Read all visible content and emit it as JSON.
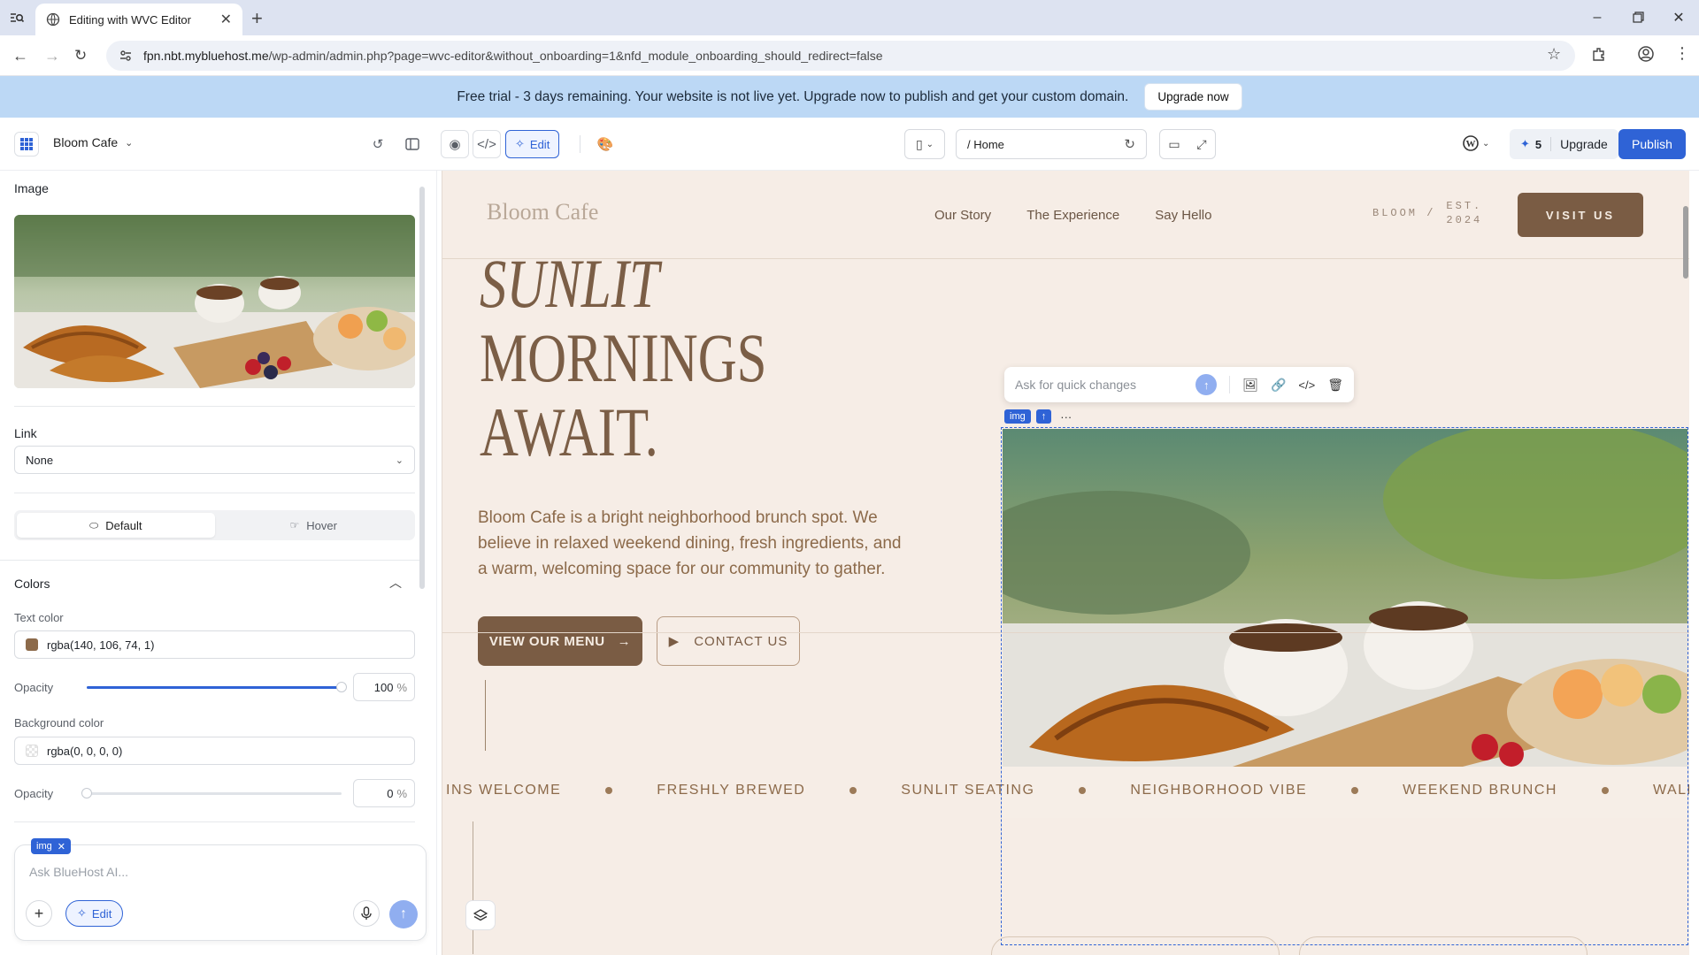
{
  "browser": {
    "tab_title": "Editing with WVC Editor",
    "url_host": "fpn.nbt.mybluehost.me",
    "url_path": "/wp-admin/admin.php?page=wvc-editor&without_onboarding=1&nfd_module_onboarding_should_redirect=false"
  },
  "banner": {
    "message": "Free trial - 3 days remaining. Your website is not live yet. Upgrade now to publish and get your custom domain.",
    "upgrade_label": "Upgrade now"
  },
  "editor": {
    "site_name": "Bloom Cafe",
    "edit_label": "Edit",
    "page_path": "/ Home",
    "credits": "5",
    "upgrade_label": "Upgrade",
    "publish_label": "Publish"
  },
  "sidebar": {
    "image_label": "Image",
    "link_label": "Link",
    "link_value": "None",
    "state_default": "Default",
    "state_hover": "Hover",
    "colors_label": "Colors",
    "text_color_label": "Text color",
    "text_color_value": "rgba(140, 106, 74, 1)",
    "text_color_swatch": "#8c6a4a",
    "opacity_label": "Opacity",
    "text_opacity": "100",
    "text_opacity_fraction": 1.0,
    "percent": "%",
    "bg_color_label": "Background color",
    "bg_color_value": "rgba(0, 0, 0, 0)",
    "bg_opacity": "0",
    "bg_opacity_fraction": 0.0
  },
  "ai": {
    "chip": "img",
    "placeholder": "Ask BlueHost AI...",
    "edit_label": "Edit"
  },
  "site": {
    "logo": "Bloom Cafe",
    "nav": [
      "Our Story",
      "The Experience",
      "Say Hello"
    ],
    "badge_left": "BLOOM /",
    "badge_right_1": "EST.",
    "badge_right_2": "2024",
    "visit_label": "VISIT US",
    "headline_1": "SUNLIT",
    "headline_2": "MORNINGS",
    "headline_3": "AWAIT.",
    "body": "Bloom Cafe is a bright neighborhood brunch spot. We believe in relaxed weekend dining, fresh ingredients, and a warm, welcoming space for our community to gather.",
    "menu_btn": "VIEW OUR MENU",
    "contact_btn": "CONTACT US",
    "ticker": [
      "INS WELCOME",
      "FRESHLY BREWED",
      "SUNLIT SEATING",
      "NEIGHBORHOOD VIBE",
      "WEEKEND BRUNCH",
      "WALK-INS WELCOME"
    ]
  },
  "quick": {
    "placeholder": "Ask for quick changes",
    "tag": "img"
  },
  "colors": {
    "brand_brown": "#8c6a4a",
    "publish_blue": "#2f63d6",
    "banner_blue": "#bcd8f5"
  }
}
